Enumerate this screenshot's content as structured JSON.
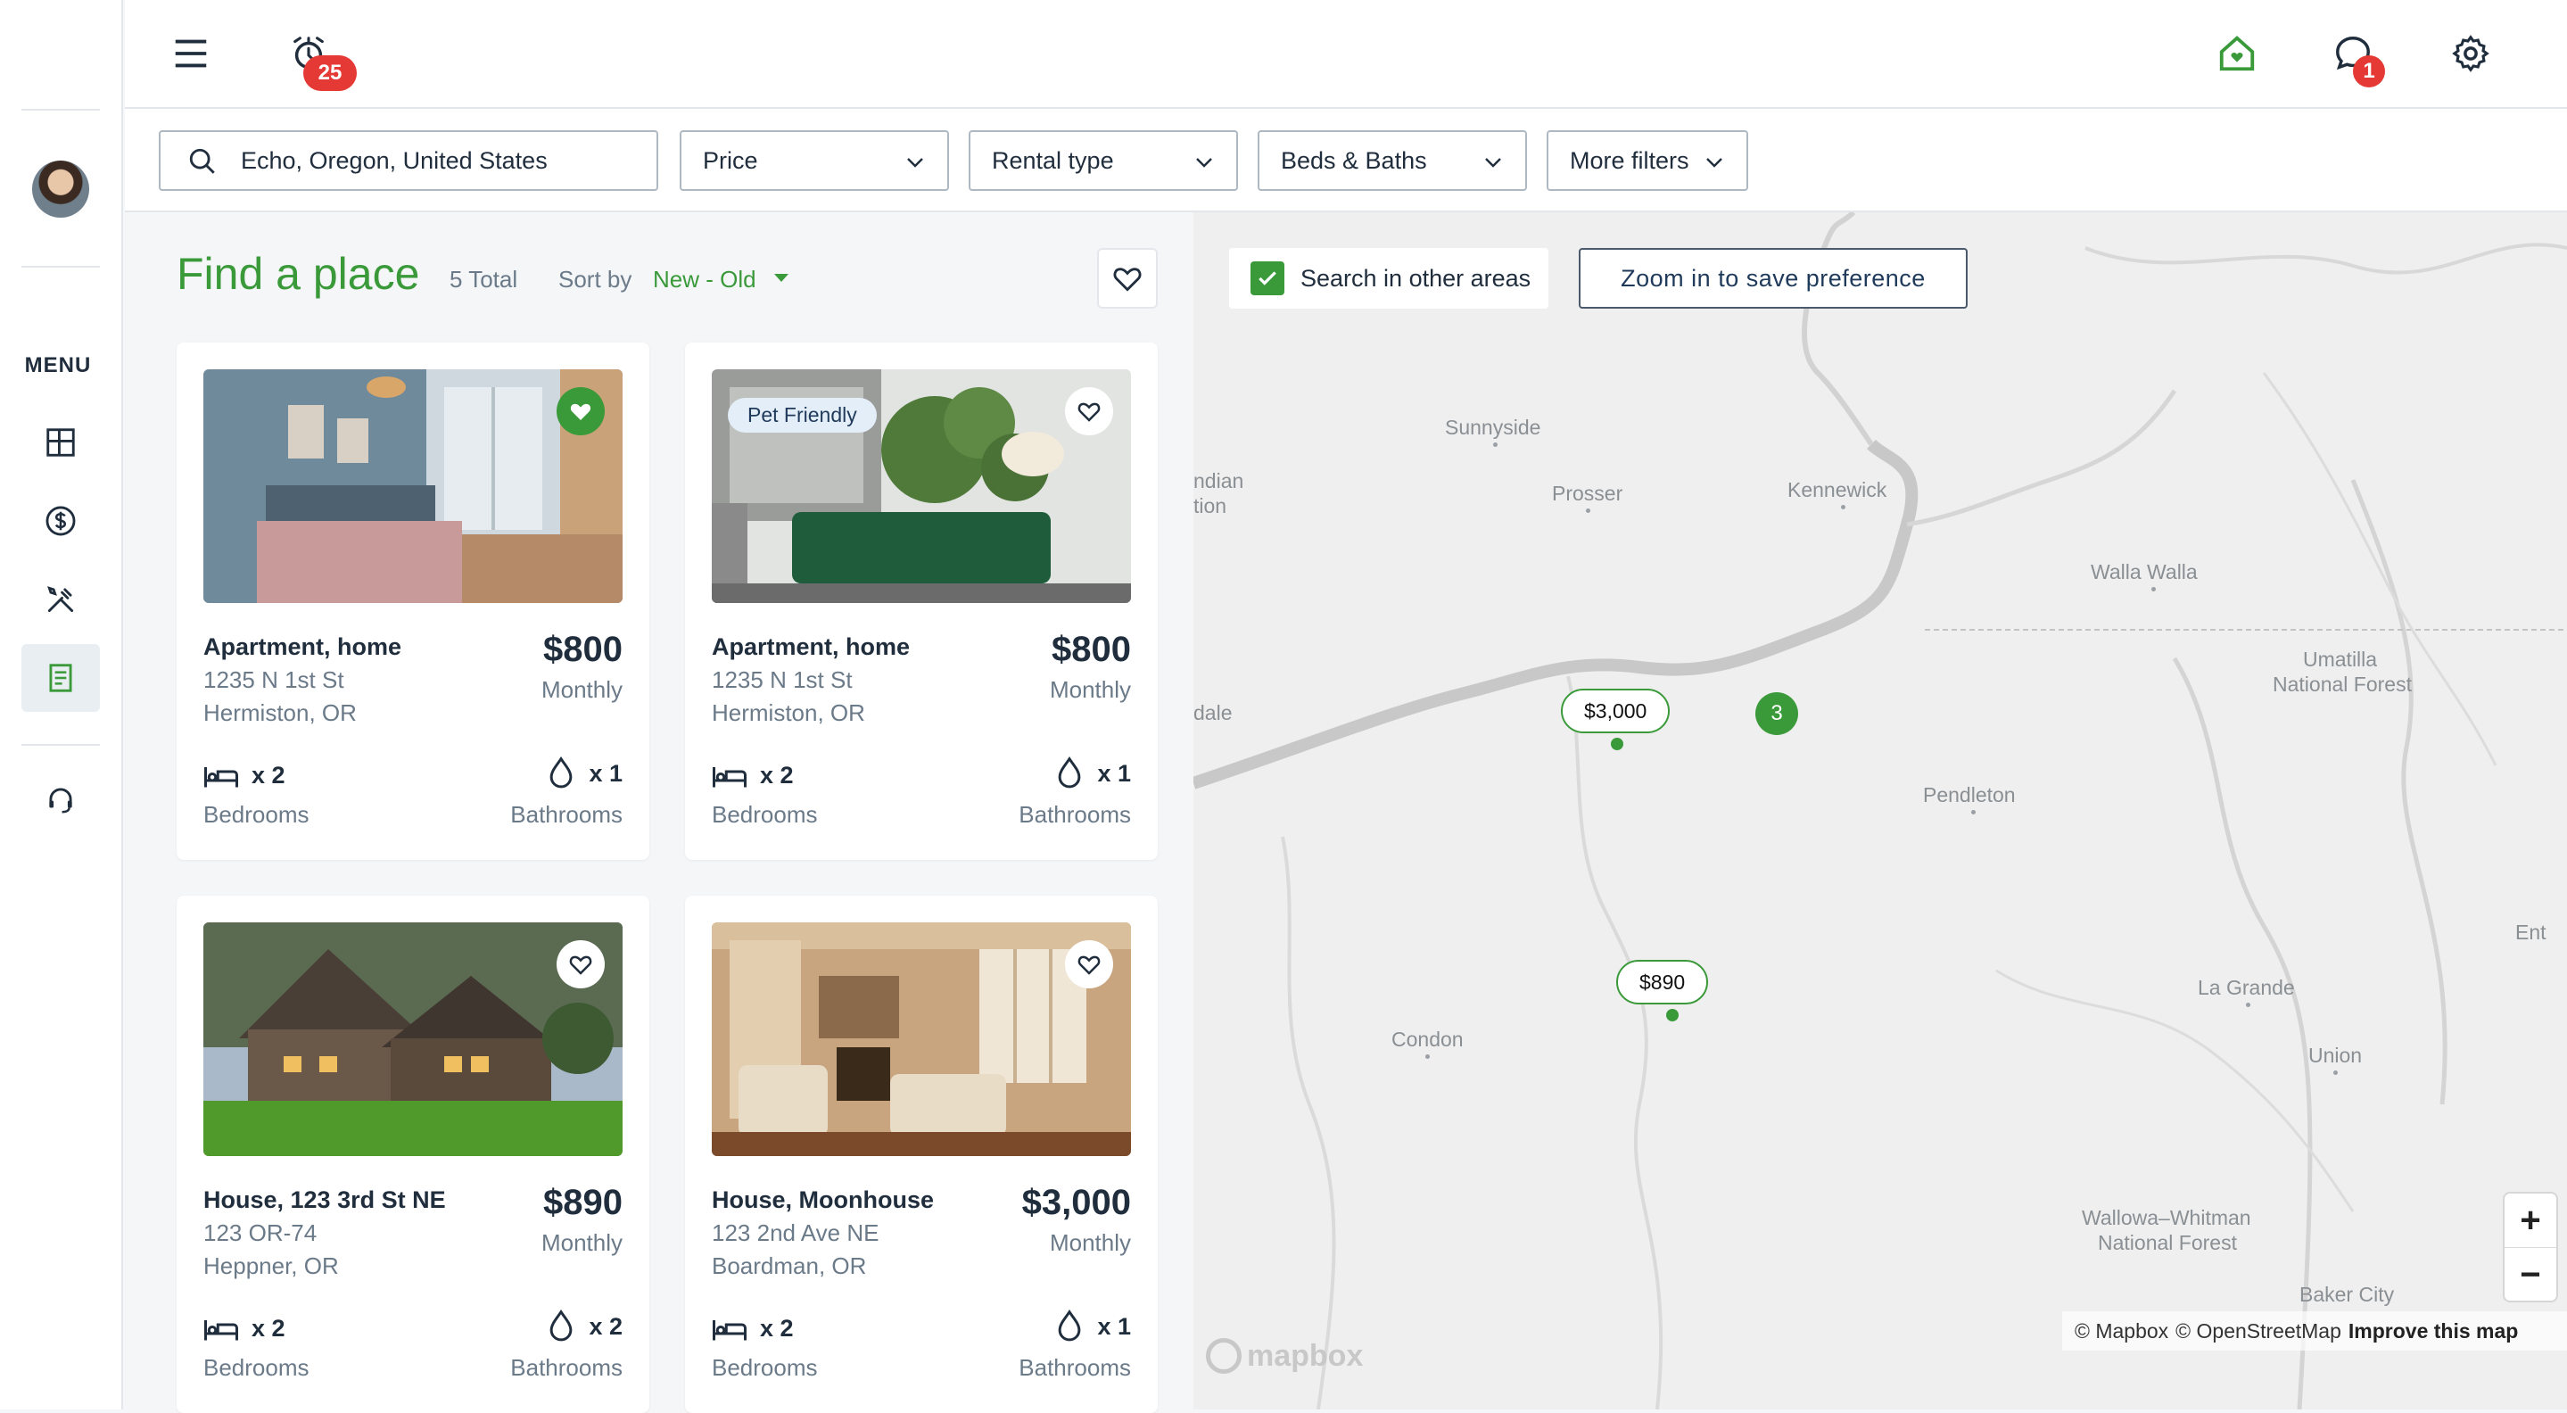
{
  "app": {
    "notification_count": "25",
    "message_count": "1"
  },
  "sidebar": {
    "menu_label": "MENU",
    "items": [
      {
        "name": "dashboard",
        "icon": "dashboard-icon"
      },
      {
        "name": "payments",
        "icon": "dollar-icon"
      },
      {
        "name": "maintenance",
        "icon": "tools-icon"
      },
      {
        "name": "listings",
        "icon": "document-icon",
        "active": true
      },
      {
        "name": "support",
        "icon": "headset-icon"
      }
    ]
  },
  "filters": {
    "search_value": "Echo, Oregon, United States",
    "price_label": "Price",
    "rental_type_label": "Rental type",
    "beds_baths_label": "Beds & Baths",
    "more_filters_label": "More filters"
  },
  "list": {
    "title": "Find a place",
    "total": "5 Total",
    "sort_label": "Sort by",
    "sort_value": "New - Old"
  },
  "listings": [
    {
      "title": "Apartment, home",
      "address1": "1235 N 1st St",
      "address2": "Hermiston, OR",
      "price": "$800",
      "period": "Monthly",
      "beds": "x 2",
      "beds_label": "Bedrooms",
      "baths": "x 1",
      "baths_label": "Bathrooms",
      "favorite": true,
      "badge": ""
    },
    {
      "title": "Apartment, home",
      "address1": "1235 N 1st St",
      "address2": "Hermiston, OR",
      "price": "$800",
      "period": "Monthly",
      "beds": "x 2",
      "beds_label": "Bedrooms",
      "baths": "x 1",
      "baths_label": "Bathrooms",
      "favorite": false,
      "badge": "Pet Friendly"
    },
    {
      "title": "House, 123 3rd St NE",
      "address1": "123 OR-74",
      "address2": "Heppner, OR",
      "price": "$890",
      "period": "Monthly",
      "beds": "x 2",
      "beds_label": "Bedrooms",
      "baths": "x 2",
      "baths_label": "Bathrooms",
      "favorite": false,
      "badge": ""
    },
    {
      "title": "House, Moonhouse",
      "address1": "123 2nd Ave NE",
      "address2": "Boardman, OR",
      "price": "$3,000",
      "period": "Monthly",
      "beds": "x 2",
      "beds_label": "Bedrooms",
      "baths": "x 1",
      "baths_label": "Bathrooms",
      "favorite": false,
      "badge": ""
    }
  ],
  "map": {
    "search_other_areas": "Search in other areas",
    "zoom_to_save": "Zoom in to save preference",
    "markers": [
      "$3,000",
      "$890"
    ],
    "cluster_count": "3",
    "places": [
      "Sunnyside",
      "Prosser",
      "Kennewick",
      "Walla Walla",
      "Umatilla",
      "National Forest",
      "Pendleton",
      "La Grande",
      "Union",
      "Condon",
      "Wallowa–Whitman",
      "National Forest",
      "Baker City",
      "ndian",
      "tion",
      "dale",
      "Ent"
    ],
    "zoom_in": "+",
    "zoom_out": "−",
    "attribution_mapbox": "© Mapbox",
    "attribution_osm": "© OpenStreetMap",
    "attribution_improve": "Improve this map",
    "logo": "mapbox"
  },
  "colors": {
    "accent_green": "#3a9a3a",
    "badge_red": "#e53935",
    "text_dark": "#1f2d3d",
    "text_muted": "#6b7a89"
  }
}
